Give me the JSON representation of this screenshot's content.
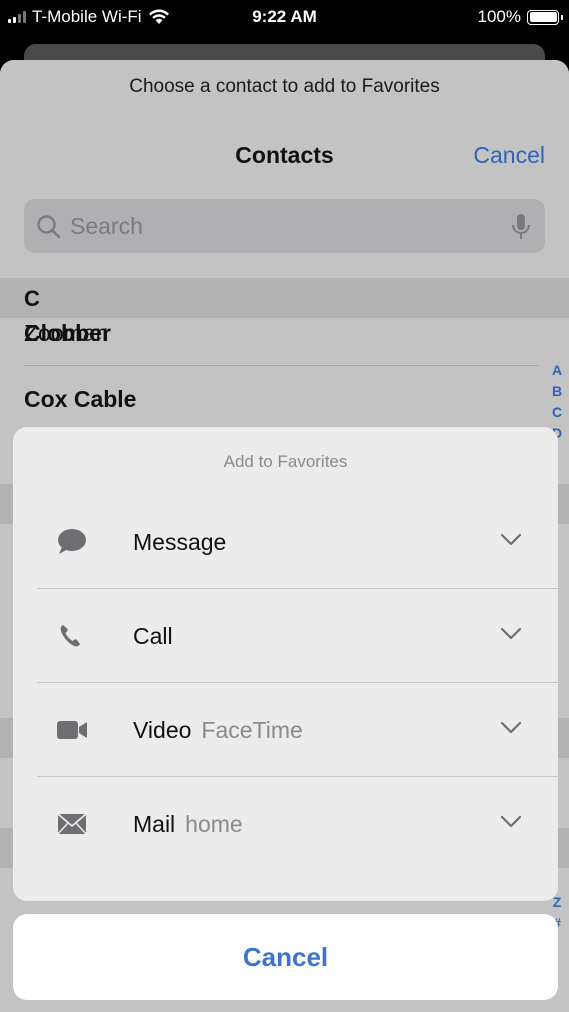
{
  "status": {
    "carrier": "T-Mobile Wi-Fi",
    "time": "9:22 AM",
    "battery": "100%"
  },
  "contacts_sheet": {
    "prompt": "Choose a contact to add to Favorites",
    "title": "Contacts",
    "cancel_label": "Cancel",
    "search_placeholder": "Search",
    "section_letter": "C",
    "rows": [
      {
        "first": "Zooman",
        "last": "Clobber"
      },
      {
        "name": "Cox Cable"
      }
    ],
    "index_letters_top": [
      "A",
      "B",
      "C",
      "D"
    ],
    "index_letters_bottom": [
      "Z",
      "#"
    ]
  },
  "action_sheet": {
    "title": "Add to Favorites",
    "options": [
      {
        "label": "Message",
        "sub": "",
        "icon": "message-bubble-icon"
      },
      {
        "label": "Call",
        "sub": "",
        "icon": "phone-icon"
      },
      {
        "label": "Video",
        "sub": "FaceTime",
        "icon": "video-camera-icon"
      },
      {
        "label": "Mail",
        "sub": "home",
        "icon": "envelope-icon"
      }
    ],
    "cancel_label": "Cancel"
  },
  "colors": {
    "accent": "#3e74cb",
    "overlay": "#c3c3c3",
    "action_bg": "#ececec"
  }
}
